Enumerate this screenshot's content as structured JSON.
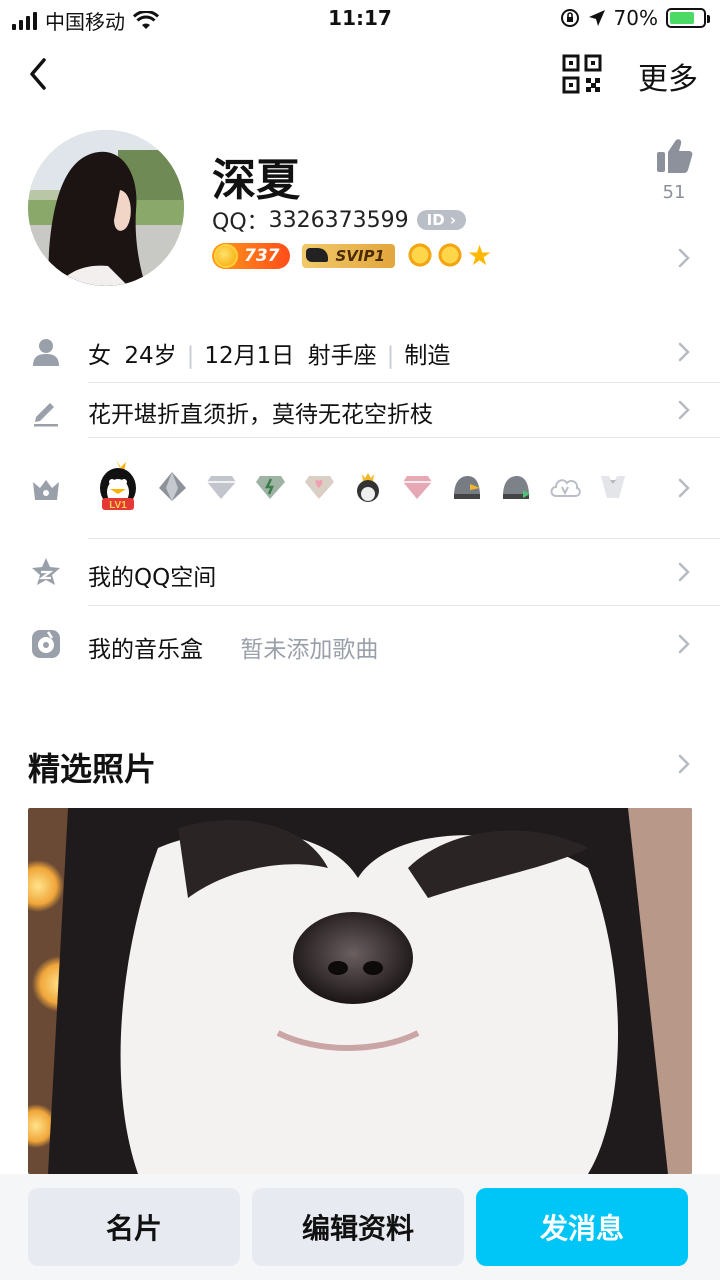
{
  "status_bar": {
    "carrier": "中国移动",
    "time": "11:17",
    "battery": "70%"
  },
  "nav": {
    "more_label": "更多"
  },
  "profile": {
    "name": "深夏",
    "qq_label": "QQ：",
    "qq_number": "3326373599",
    "id_badge": "ID",
    "coin_level": "737",
    "svip_label": "SVIP1",
    "likes": "51"
  },
  "rows": {
    "info": {
      "gender": "女",
      "age": "24岁",
      "birthday": "12月1日",
      "zodiac": "射手座",
      "occupation": "制造"
    },
    "signature": "花开堪折直须折，莫待无花空折枝",
    "qzone": "我的QQ空间",
    "music": {
      "label": "我的音乐盒",
      "placeholder": "暂未添加歌曲"
    }
  },
  "medals": {
    "first_label": "LV1"
  },
  "featured": {
    "title": "精选照片"
  },
  "actions": {
    "card": "名片",
    "edit": "编辑资料",
    "message": "发消息"
  },
  "colors": {
    "accent": "#00c6f7",
    "secondary_button": "#e7eaf0",
    "chevron": "#b6bbc3"
  }
}
